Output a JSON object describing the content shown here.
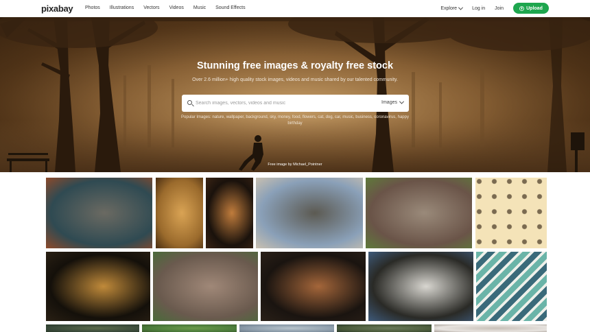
{
  "header": {
    "logo": "pixabay",
    "nav": [
      "Photos",
      "Illustrations",
      "Vectors",
      "Videos",
      "Music",
      "Sound Effects"
    ],
    "explore": "Explore",
    "login": "Log in",
    "join": "Join",
    "upload": "Upload"
  },
  "hero": {
    "title": "Stunning free images & royalty free stock",
    "subtitle": "Over 2.6 million+ high quality stock images, videos and music shared by our talented community.",
    "search_placeholder": "Search images, vectors, videos and music",
    "search_type": "Images",
    "popular": "Popular Images: nature, wallpaper, background, sky, money, food, flowers, cat, dog, car, music, business, coronavirus, happy birthday",
    "credit": "Free image by Michael_Pointner"
  },
  "colors": {
    "accent": "#1ea64e",
    "hero_tone": "#8a6236"
  },
  "gallery": [
    {
      "name": "rocks-and-sea",
      "palette": [
        "#2f4a52",
        "#6b6a62",
        "#8e4a2a"
      ]
    },
    {
      "name": "lion",
      "palette": [
        "#9a6a2c",
        "#d9a354",
        "#4a2e12"
      ]
    },
    {
      "name": "dark-leaves",
      "palette": [
        "#1a120c",
        "#c07c3c",
        "#3a2414"
      ]
    },
    {
      "name": "old-town",
      "palette": [
        "#8aa0b8",
        "#5c5a52",
        "#c9c0b0"
      ]
    },
    {
      "name": "sparrow-on-branch",
      "palette": [
        "#6a5448",
        "#9a8a7a",
        "#5f7a3a"
      ]
    },
    {
      "name": "coffee-pattern",
      "palette": [
        "#f4e3b8",
        "#7a6a50",
        "#f4e3b8"
      ]
    },
    {
      "name": "bee-macro",
      "palette": [
        "#14100a",
        "#c08a3a",
        "#2a2014"
      ]
    },
    {
      "name": "river-stones",
      "palette": [
        "#6a5a4e",
        "#a08878",
        "#4a6a3a"
      ]
    },
    {
      "name": "fox",
      "palette": [
        "#1a1410",
        "#a4663a",
        "#2a2018"
      ]
    },
    {
      "name": "vase-by-window",
      "palette": [
        "#2a2a26",
        "#d8d6d0",
        "#3e5a7a"
      ]
    },
    {
      "name": "teal-chevron",
      "palette": [
        "#6ab4a8",
        "#eef0ea",
        "#3a6a7a"
      ]
    },
    {
      "name": "row3-1",
      "palette": [
        "#3a4a3a",
        "#5a6a4a",
        "#2a3a2a"
      ]
    },
    {
      "name": "row3-2",
      "palette": [
        "#4a7a3a",
        "#6a9a4a",
        "#3a5a2a"
      ]
    },
    {
      "name": "row3-3",
      "palette": [
        "#8a9aa8",
        "#b8c4cc",
        "#6a7a88"
      ]
    },
    {
      "name": "row3-4",
      "palette": [
        "#4a5a3a",
        "#6a7a5a",
        "#2a3a2a"
      ]
    },
    {
      "name": "row3-5",
      "palette": [
        "#e8e4e0",
        "#c8c0b8",
        "#a8a098"
      ]
    }
  ]
}
